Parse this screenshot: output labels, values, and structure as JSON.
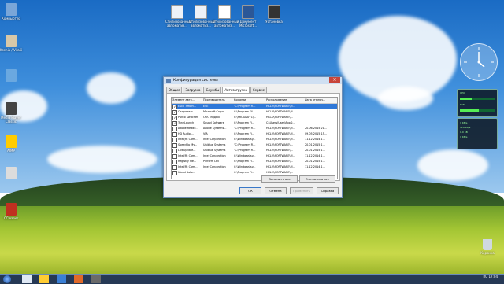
{
  "desktop": {
    "left_icons": [
      {
        "label": "Компьютер",
        "color": "#7aa6d8"
      },
      {
        "label": "Ksenia / Vitalii",
        "color": "#d8c8a8"
      },
      {
        "label": "",
        "color": "#6aa8e0"
      },
      {
        "label": "Media Player Classic",
        "color": "#444444"
      },
      {
        "label": "AIMP",
        "color": "#ffcc00"
      },
      {
        "label": "",
        "color": "#dcdcdc"
      },
      {
        "label": "CCleaner",
        "color": "#c03020"
      }
    ],
    "top_icons": [
      {
        "label": "Стилизованный автоматиз...",
        "color": "#eef2f8"
      },
      {
        "label": "Стилизованный автоматиз...",
        "color": "#eef2f8"
      },
      {
        "label": "Стилизованный автоматиз...",
        "color": "#ffffff"
      },
      {
        "label": "Документ Microsoft...",
        "color": "#2b5797"
      },
      {
        "label": "Установка",
        "color": "#333333"
      }
    ],
    "recycle_bin_label": "Корзина"
  },
  "window": {
    "title": "Конфигурация системы",
    "close_glyph": "×",
    "tabs": [
      {
        "label": "Общие",
        "active": false
      },
      {
        "label": "Загрузка",
        "active": false
      },
      {
        "label": "Службы",
        "active": false
      },
      {
        "label": "Автозагрузка",
        "active": true
      },
      {
        "label": "Сервис",
        "active": false
      }
    ],
    "columns": [
      "Элемент авто...",
      "Производитель",
      "Команда",
      "Расположение",
      "Дата отключ..."
    ],
    "rows": [
      {
        "checked": true,
        "selected": true,
        "cells": [
          "ESET Smart...",
          "ESET",
          "\"C:\\Program Fi...",
          "HKLM\\SOFTWARE\\M...",
          ""
        ]
      },
      {
        "checked": true,
        "selected": false,
        "cells": [
          "Отправить...",
          "Microsoft Corpo...",
          "C:\\Program Fil...",
          "HKLM\\SOFTWARE\\M...",
          ""
        ]
      },
      {
        "checked": true,
        "selected": false,
        "cells": [
          "Punto Switcher",
          "ООО Яндекс",
          "C:\\PROGRA~1\\...",
          "HKCU\\SOFTWARE\\...",
          ""
        ]
      },
      {
        "checked": true,
        "selected": false,
        "cells": [
          "TuneLaunch",
          "Sound Software",
          "C:\\Program Fi...",
          "C:\\Users\\User\\AppD...",
          ""
        ]
      },
      {
        "checked": false,
        "selected": false,
        "cells": [
          "Adobe Reade...",
          "Adobe Systems...",
          "\"C:\\Program Fi...",
          "HKLM\\SOFTWARE\\M...",
          "20.06.2015 21..."
        ]
      },
      {
        "checked": false,
        "selected": false,
        "cells": [
          "HD Audio ...",
          "VIA",
          "C:\\Program Fi...",
          "HKLM\\SOFTWARE\\M...",
          "09.05.2015 15..."
        ]
      },
      {
        "checked": false,
        "selected": false,
        "cells": [
          "Intel(R) Com...",
          "Intel Corporation",
          "C:\\Windows\\sy...",
          "HKLM\\SOFTWARE\\M...",
          "11.12.2014 1..."
        ]
      },
      {
        "checked": false,
        "selected": false,
        "cells": [
          "SpeedUp My...",
          "Uniblue Systems",
          "\"C:\\Program Fi...",
          "HKLM\\SOFTWARE\\...",
          "20.01.2015 1..."
        ]
      },
      {
        "checked": false,
        "selected": false,
        "cells": [
          "LiveUpdate...",
          "Uniblue Systems",
          "\"C:\\Program Fi...",
          "HKLM\\SOFTWARE\\...",
          "20.01.2015 1..."
        ]
      },
      {
        "checked": false,
        "selected": false,
        "cells": [
          "Intel(R) Com...",
          "Intel Corporation",
          "C:\\Windows\\sy...",
          "HKLM\\SOFTWARE\\M...",
          "11.12.2014 1..."
        ]
      },
      {
        "checked": false,
        "selected": false,
        "cells": [
          "Registry Me...",
          "Piriform Ltd",
          "C:\\Program Fi...",
          "HKLM\\SOFTWARE\\...",
          "20.01.2015 1..."
        ]
      },
      {
        "checked": false,
        "selected": false,
        "cells": [
          "Intel(R) Com...",
          "Intel Corporation",
          "C:\\Windows\\sy...",
          "HKLM\\SOFTWARE\\M...",
          "11.12.2014 1..."
        ]
      },
      {
        "checked": false,
        "selected": false,
        "cells": [
          "Ulead Auto...",
          "",
          "C:\\Program Fi...",
          "HKLM\\SOFTWARE\\...",
          ""
        ]
      }
    ],
    "enable_all": "Включить все",
    "disable_all": "Отключить все",
    "ok": "ОК",
    "cancel": "Отмена",
    "apply": "Применить",
    "help": "Справка"
  },
  "gadgets": {
    "cpu_label": "CPU",
    "ram_label": "RAM",
    "cpu_value": 0.35,
    "ram_value": 0.55,
    "net_lines": [
      "1 KB/s",
      "128 KB/s",
      "0.0 KB",
      "1 KB/s"
    ]
  },
  "taskbar": {
    "time": "17:04",
    "lang": "RU",
    "buttons": [
      {
        "color": "#dfe8f4"
      },
      {
        "color": "#ffcc33"
      },
      {
        "color": "#3a7fd5"
      },
      {
        "color": "#e06a2a"
      },
      {
        "color": "#6a6a6a"
      }
    ]
  }
}
